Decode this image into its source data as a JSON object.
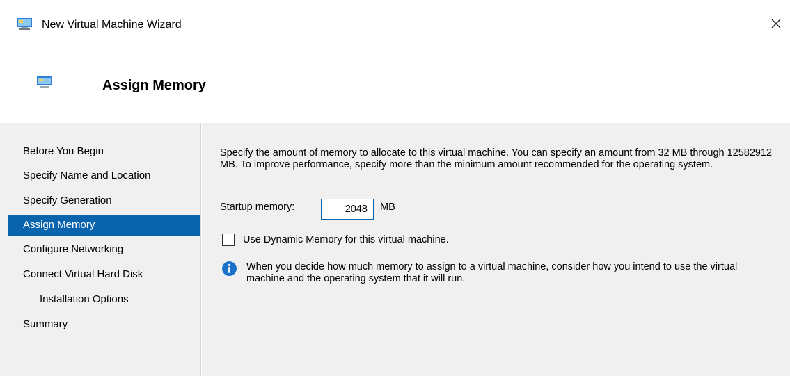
{
  "window": {
    "title": "New Virtual Machine Wizard",
    "close_icon": "close-icon",
    "app_icon": "vm-monitor-icon"
  },
  "header": {
    "title": "Assign Memory",
    "icon": "memory-monitor-icon"
  },
  "sidebar": {
    "items": [
      {
        "label": "Before You Begin",
        "active": false,
        "indent": false
      },
      {
        "label": "Specify Name and Location",
        "active": false,
        "indent": false
      },
      {
        "label": "Specify Generation",
        "active": false,
        "indent": false
      },
      {
        "label": "Assign Memory",
        "active": true,
        "indent": false
      },
      {
        "label": "Configure Networking",
        "active": false,
        "indent": false
      },
      {
        "label": "Connect Virtual Hard Disk",
        "active": false,
        "indent": false
      },
      {
        "label": "Installation Options",
        "active": false,
        "indent": true
      },
      {
        "label": "Summary",
        "active": false,
        "indent": false
      }
    ]
  },
  "main": {
    "description": "Specify the amount of memory to allocate to this virtual machine. You can specify an amount from 32 MB through 12582912 MB. To improve performance, specify more than the minimum amount recommended for the operating system.",
    "startup_memory_label": "Startup memory:",
    "startup_memory_value": "2048",
    "startup_memory_unit": "MB",
    "dynamic_memory_label": "Use Dynamic Memory for this virtual machine.",
    "dynamic_memory_checked": false,
    "info_text": "When you decide how much memory to assign to a virtual machine, consider how you intend to use the virtual machine and the operating system that it will run."
  },
  "colors": {
    "accent": "#0a64ad",
    "panel_bg": "#f0f0f0",
    "info_blue": "#1a73c8"
  }
}
